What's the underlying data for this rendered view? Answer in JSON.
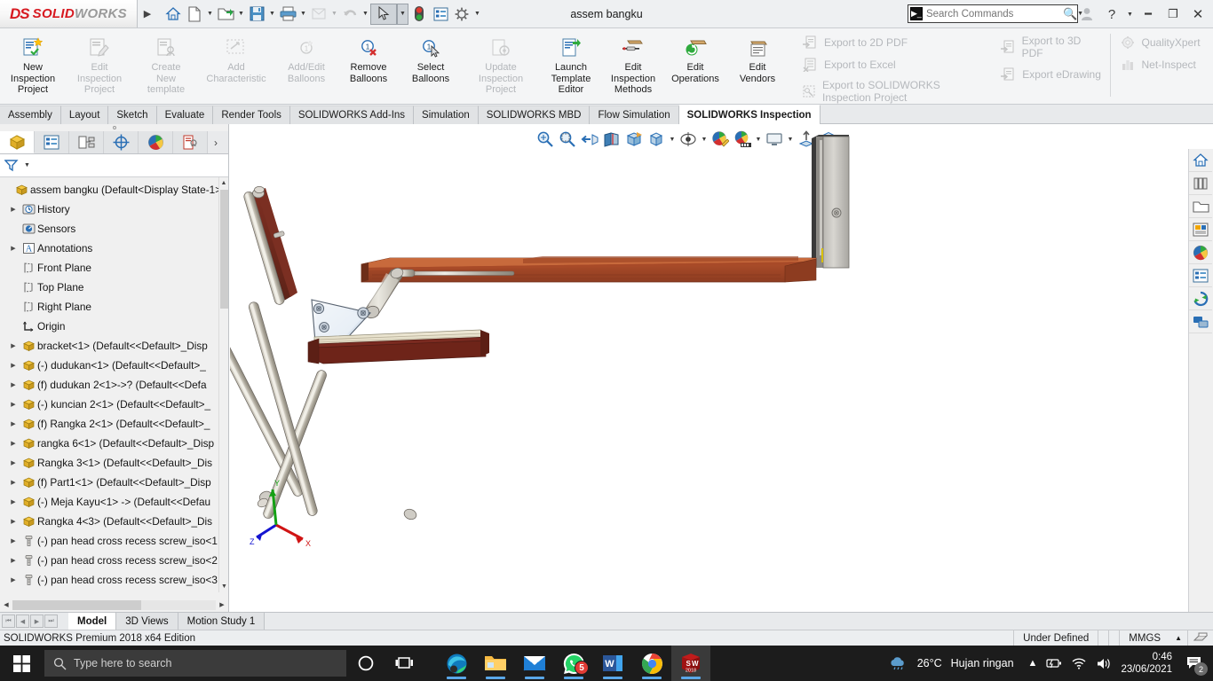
{
  "titlebar": {
    "logo_ds": "DS",
    "logo_solid": "SOLID",
    "logo_works": "WORKS",
    "document_title": "assem bangku",
    "search_placeholder": "Search Commands",
    "tools": [
      {
        "name": "home-icon",
        "glyph": "⌂"
      },
      {
        "name": "new-document-icon",
        "glyph": "὜B"
      },
      {
        "name": "open-folder-icon",
        "glyph": "὜1"
      },
      {
        "name": "save-icon",
        "glyph": "ὋE"
      },
      {
        "name": "print-icon",
        "glyph": "⎙"
      },
      {
        "name": "undo-icon",
        "glyph": "↶"
      },
      {
        "name": "redo-icon",
        "glyph": "↷"
      },
      {
        "name": "select-cursor-icon",
        "glyph": "➤"
      },
      {
        "name": "rebuild-icon",
        "glyph": "●"
      },
      {
        "name": "options-list-icon",
        "glyph": "☰"
      },
      {
        "name": "settings-gear-icon",
        "glyph": "⚙"
      }
    ],
    "window_buttons": [
      {
        "name": "user-account-icon",
        "glyph": "὆4"
      },
      {
        "name": "help-icon",
        "glyph": "?"
      },
      {
        "name": "minimize-button",
        "glyph": "—"
      },
      {
        "name": "restore-button",
        "glyph": "❐"
      },
      {
        "name": "close-button",
        "glyph": "✕"
      }
    ]
  },
  "ribbon": {
    "buttons": [
      {
        "label": "New\nInspection\nProject",
        "enabled": true,
        "name": "new-inspection-project-button"
      },
      {
        "label": "Edit\nInspection\nProject",
        "enabled": false,
        "name": "edit-inspection-project-button"
      },
      {
        "label": "Create\nNew\ntemplate",
        "enabled": false,
        "name": "create-new-template-button"
      },
      {
        "label": "Add\nCharacteristic",
        "enabled": false,
        "name": "add-characteristic-button"
      },
      {
        "label": "Add/Edit\nBalloons",
        "enabled": false,
        "name": "add-edit-balloons-button"
      },
      {
        "label": "Remove\nBalloons",
        "enabled": true,
        "name": "remove-balloons-button"
      },
      {
        "label": "Select\nBalloons",
        "enabled": true,
        "name": "select-balloons-button"
      },
      {
        "label": "Update\nInspection\nProject",
        "enabled": false,
        "name": "update-inspection-project-button"
      },
      {
        "label": "Launch\nTemplate\nEditor",
        "enabled": true,
        "name": "launch-template-editor-button"
      },
      {
        "label": "Edit\nInspection\nMethods",
        "enabled": true,
        "name": "edit-inspection-methods-button"
      },
      {
        "label": "Edit\nOperations",
        "enabled": true,
        "name": "edit-operations-button"
      },
      {
        "label": "Edit\nVendors",
        "enabled": true,
        "name": "edit-vendors-button"
      }
    ],
    "export_col1": [
      {
        "label": "Export to 2D PDF",
        "name": "export-2d-pdf-item"
      },
      {
        "label": "Export to Excel",
        "name": "export-excel-item"
      },
      {
        "label": "Export to SOLIDWORKS Inspection Project",
        "name": "export-sw-inspection-item"
      }
    ],
    "export_col2": [
      {
        "label": "Export to 3D PDF",
        "name": "export-3d-pdf-item"
      },
      {
        "label": "Export eDrawing",
        "name": "export-edrawing-item"
      }
    ],
    "export_col3": [
      {
        "label": "QualityXpert",
        "name": "qualityxpert-item"
      },
      {
        "label": "Net-Inspect",
        "name": "net-inspect-item"
      }
    ]
  },
  "tabs": [
    {
      "label": "Assembly",
      "active": false
    },
    {
      "label": "Layout",
      "active": false
    },
    {
      "label": "Sketch",
      "active": false
    },
    {
      "label": "Evaluate",
      "active": false
    },
    {
      "label": "Render Tools",
      "active": false
    },
    {
      "label": "SOLIDWORKS Add-Ins",
      "active": false
    },
    {
      "label": "Simulation",
      "active": false
    },
    {
      "label": "SOLIDWORKS MBD",
      "active": false
    },
    {
      "label": "Flow Simulation",
      "active": false
    },
    {
      "label": "SOLIDWORKS Inspection",
      "active": true
    }
  ],
  "tree_tabs": [
    {
      "name": "feature-manager-tab",
      "active": true
    },
    {
      "name": "property-manager-tab",
      "active": false
    },
    {
      "name": "configuration-manager-tab",
      "active": false
    },
    {
      "name": "dimxpert-manager-tab",
      "active": false
    },
    {
      "name": "display-manager-tab",
      "active": false
    },
    {
      "name": "inspection-manager-tab",
      "active": false
    }
  ],
  "tree": [
    {
      "label": "assem bangku  (Default<Display State-1>)",
      "icon": "assembly-icon",
      "indent": 0,
      "expand": false
    },
    {
      "label": "History",
      "icon": "history-icon",
      "indent": 1,
      "expand": true
    },
    {
      "label": "Sensors",
      "icon": "sensors-icon",
      "indent": 1,
      "expand": false
    },
    {
      "label": "Annotations",
      "icon": "annotations-icon",
      "indent": 1,
      "expand": true
    },
    {
      "label": "Front Plane",
      "icon": "plane-icon",
      "indent": 1,
      "expand": false
    },
    {
      "label": "Top Plane",
      "icon": "plane-icon",
      "indent": 1,
      "expand": false
    },
    {
      "label": "Right Plane",
      "icon": "plane-icon",
      "indent": 1,
      "expand": false
    },
    {
      "label": "Origin",
      "icon": "origin-icon",
      "indent": 1,
      "expand": false
    },
    {
      "label": "bracket<1>  (Default<<Default>_Disp",
      "icon": "part-icon",
      "indent": 1,
      "expand": true
    },
    {
      "label": "(-) dudukan<1>  (Default<<Default>_",
      "icon": "part-icon",
      "indent": 1,
      "expand": true
    },
    {
      "label": "(f) dudukan 2<1>->?  (Default<<Defa",
      "icon": "part-icon",
      "indent": 1,
      "expand": true
    },
    {
      "label": "(-) kuncian 2<1>  (Default<<Default>_",
      "icon": "part-icon",
      "indent": 1,
      "expand": true
    },
    {
      "label": "(f) Rangka 2<1>  (Default<<Default>_",
      "icon": "part-icon",
      "indent": 1,
      "expand": true
    },
    {
      "label": "rangka 6<1>  (Default<<Default>_Disp",
      "icon": "part-icon",
      "indent": 1,
      "expand": true
    },
    {
      "label": "Rangka 3<1>  (Default<<Default>_Dis",
      "icon": "part-icon",
      "indent": 1,
      "expand": true
    },
    {
      "label": "(f) Part1<1>  (Default<<Default>_Disp",
      "icon": "part-icon",
      "indent": 1,
      "expand": true
    },
    {
      "label": "(-) Meja Kayu<1> ->  (Default<<Defau",
      "icon": "part-icon",
      "indent": 1,
      "expand": true
    },
    {
      "label": "Rangka 4<3>  (Default<<Default>_Dis",
      "icon": "part-icon",
      "indent": 1,
      "expand": true
    },
    {
      "label": "(-) pan head cross recess screw_iso<1",
      "icon": "screw-icon",
      "indent": 1,
      "expand": true
    },
    {
      "label": "(-) pan head cross recess screw_iso<2",
      "icon": "screw-icon",
      "indent": 1,
      "expand": true
    },
    {
      "label": "(-) pan head cross recess screw_iso<3",
      "icon": "screw-icon",
      "indent": 1,
      "expand": true
    }
  ],
  "view_toolbar": [
    {
      "name": "zoom-to-fit-icon",
      "caret": false
    },
    {
      "name": "zoom-to-area-icon",
      "caret": false
    },
    {
      "name": "previous-view-icon",
      "caret": false
    },
    {
      "name": "section-view-icon",
      "caret": false
    },
    {
      "name": "view-orientation-icon",
      "caret": false
    },
    {
      "name": "display-style-icon",
      "caret": true
    },
    {
      "name": "hide-show-items-icon",
      "caret": true
    },
    {
      "name": "edit-appearance-icon",
      "caret": false
    },
    {
      "name": "apply-scene-icon",
      "caret": true
    },
    {
      "name": "view-settings-icon",
      "caret": true
    },
    {
      "name": "exploded-view-icon",
      "caret": false
    },
    {
      "name": "viewport-icon",
      "caret": false
    }
  ],
  "graphics_winctl": [
    {
      "name": "previous-document-button",
      "glyph": "◀"
    },
    {
      "name": "next-document-button",
      "glyph": "▶"
    },
    {
      "name": "doc-minimize-button",
      "glyph": "—"
    },
    {
      "name": "doc-restore-button",
      "glyph": "❐"
    },
    {
      "name": "doc-close-button",
      "glyph": "✕"
    }
  ],
  "task_pane": [
    {
      "name": "sw-resources-home-icon"
    },
    {
      "name": "design-library-icon"
    },
    {
      "name": "file-explorer-icon"
    },
    {
      "name": "view-palette-icon"
    },
    {
      "name": "appearances-scenes-icon"
    },
    {
      "name": "custom-properties-icon"
    },
    {
      "name": "sw-forum-icon"
    },
    {
      "name": "sw-share-icon"
    }
  ],
  "triad": {
    "x_label": "X",
    "y_label": "Y",
    "z_label": "Z"
  },
  "bottom_tabs": [
    {
      "label": "Model",
      "active": true
    },
    {
      "label": "3D Views",
      "active": false
    },
    {
      "label": "Motion Study 1",
      "active": false
    }
  ],
  "statusbar": {
    "edition": "SOLIDWORKS Premium 2018 x64 Edition",
    "state": "Under Defined",
    "units": "MMGS",
    "units_caret": "▲"
  },
  "taskbar": {
    "search_placeholder": "Type here to search",
    "icons": [
      {
        "name": "cortana-icon"
      },
      {
        "name": "task-view-icon"
      },
      {
        "name": "microsoft-edge-icon"
      },
      {
        "name": "file-explorer-icon"
      },
      {
        "name": "mail-icon"
      },
      {
        "name": "whatsapp-icon",
        "badge": "5"
      },
      {
        "name": "microsoft-word-icon"
      },
      {
        "name": "google-chrome-icon"
      },
      {
        "name": "solidworks-2018-icon",
        "label": "2018"
      }
    ],
    "weather_temp": "26°C",
    "weather_desc": "Hujan ringan",
    "time": "0:46",
    "date": "23/06/2021",
    "notification_count": "2"
  }
}
